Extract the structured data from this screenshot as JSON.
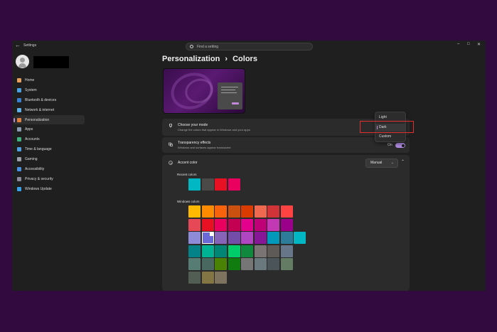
{
  "window": {
    "app_title": "Settings",
    "search_placeholder": "Find a setting",
    "controls": {
      "minimize": "–",
      "maximize": "□",
      "close": "✕"
    }
  },
  "sidebar": {
    "items": [
      {
        "label": "Home",
        "icon": "home-icon",
        "color": "#e8a060"
      },
      {
        "label": "System",
        "icon": "system-icon",
        "color": "#4aa0e0"
      },
      {
        "label": "Bluetooth & devices",
        "icon": "bluetooth-icon",
        "color": "#3a80d0"
      },
      {
        "label": "Network & internet",
        "icon": "wifi-icon",
        "color": "#60b0e8"
      },
      {
        "label": "Personalization",
        "icon": "brush-icon",
        "color": "#e08040",
        "selected": true
      },
      {
        "label": "Apps",
        "icon": "apps-icon",
        "color": "#8a9ab0"
      },
      {
        "label": "Accounts",
        "icon": "accounts-icon",
        "color": "#40b080"
      },
      {
        "label": "Time & language",
        "icon": "globe-clock-icon",
        "color": "#50a0e0"
      },
      {
        "label": "Gaming",
        "icon": "gamepad-icon",
        "color": "#9aa0aa"
      },
      {
        "label": "Accessibility",
        "icon": "accessibility-icon",
        "color": "#4a90e0"
      },
      {
        "label": "Privacy & security",
        "icon": "shield-icon",
        "color": "#8a8a9a"
      },
      {
        "label": "Windows Update",
        "icon": "update-icon",
        "color": "#3aa0e8"
      }
    ]
  },
  "main": {
    "breadcrumb_parent": "Personalization",
    "breadcrumb_separator": "›",
    "breadcrumb_current": "Colors",
    "mode": {
      "title": "Choose your mode",
      "description": "Change the colors that appear in Windows and your apps",
      "options": [
        "Light",
        "Dark",
        "Custom"
      ],
      "selected": "Dark"
    },
    "transparency": {
      "title": "Transparency effects",
      "description": "Windows and surfaces appear translucent",
      "state_label": "On"
    },
    "accent": {
      "title": "Accent color",
      "dropdown_value": "Manual",
      "recent_label": "Recent colors",
      "recent_colors": [
        "#00b7c3",
        "#4c4a48",
        "#e81123",
        "#ea005e"
      ],
      "windows_label": "Windows colors",
      "windows_colors": [
        [
          "#ffb900",
          "#ff8c00",
          "#f7630c",
          "#ca5010",
          "#da3b01",
          "#ef6950",
          "#d13438",
          "#ff4343"
        ],
        [
          "#e74856",
          "#e81123",
          "#ea005e",
          "#c30052",
          "#e3008c",
          "#bf0077",
          "#c239b3",
          "#9a0089"
        ],
        [
          "#8e8cd8",
          "#6b69d6",
          "#8764b8",
          "#744da9",
          "#b146c2",
          "#881798",
          "#0099bc",
          "#2d7d9a",
          "#00b7c3"
        ],
        [
          "#038387",
          "#00b294",
          "#018574",
          "#00cc6a",
          "#10893e",
          "#7a7574",
          "#5d5a58",
          "#68768a"
        ],
        [
          "#567c73",
          "#486860",
          "#498205",
          "#107c10",
          "#767676",
          "#69797e",
          "#4a5459",
          "#647c64"
        ],
        [
          "#525e54",
          "#847545",
          "#7e735f"
        ]
      ],
      "selected_color": "#6b69d6"
    }
  }
}
